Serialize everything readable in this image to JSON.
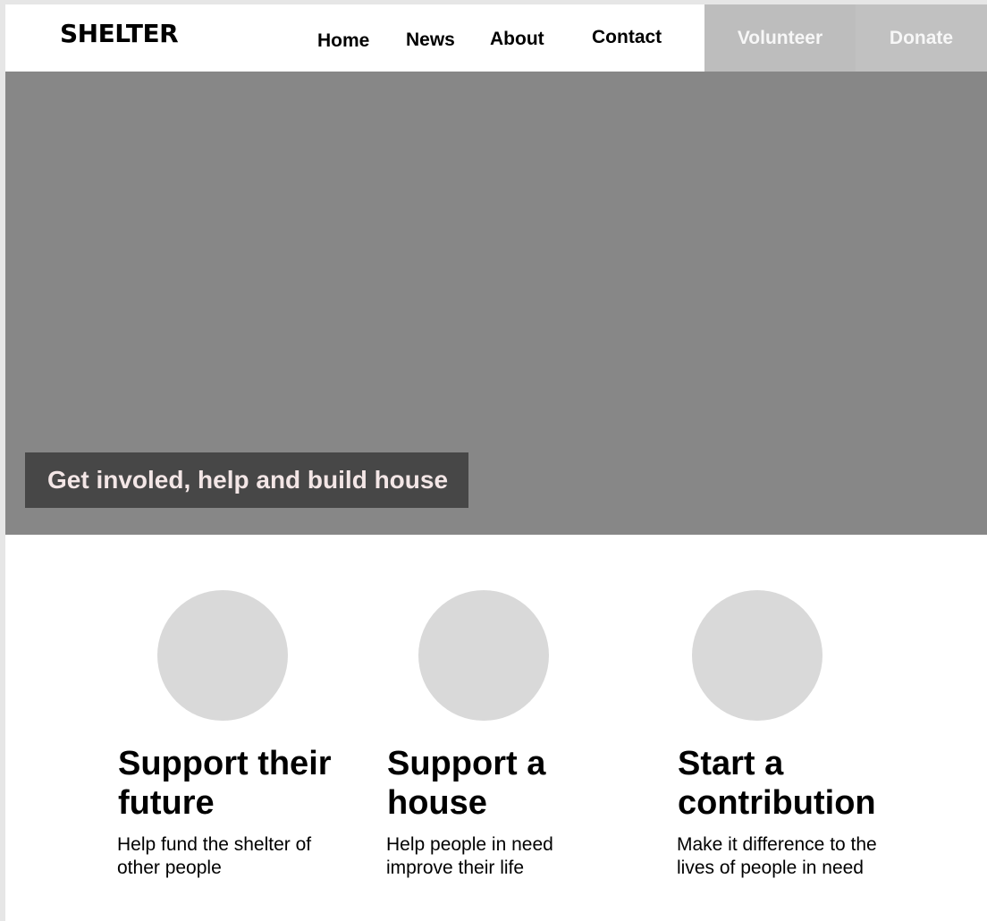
{
  "header": {
    "logo": "SHELTER",
    "nav": {
      "home": "Home",
      "news": "News",
      "about": "About",
      "contact": "Contact"
    },
    "volunteer_label": "Volunteer",
    "donate_label": "Donate"
  },
  "hero": {
    "caption": "Get involed, help and build house"
  },
  "features": [
    {
      "title": "Support their future",
      "description": "Help fund the shelter of other people"
    },
    {
      "title": "Support a house",
      "description": "Help people in need improve their life"
    },
    {
      "title": "Start a contribution",
      "description": "Make it difference to the lives of people in need"
    }
  ],
  "colors": {
    "hero_background": "#878787",
    "caption_background": "#474747",
    "volunteer_button": "#bdbdbd",
    "donate_button": "#c1c1c1",
    "feature_circle": "#d9d9d9"
  }
}
